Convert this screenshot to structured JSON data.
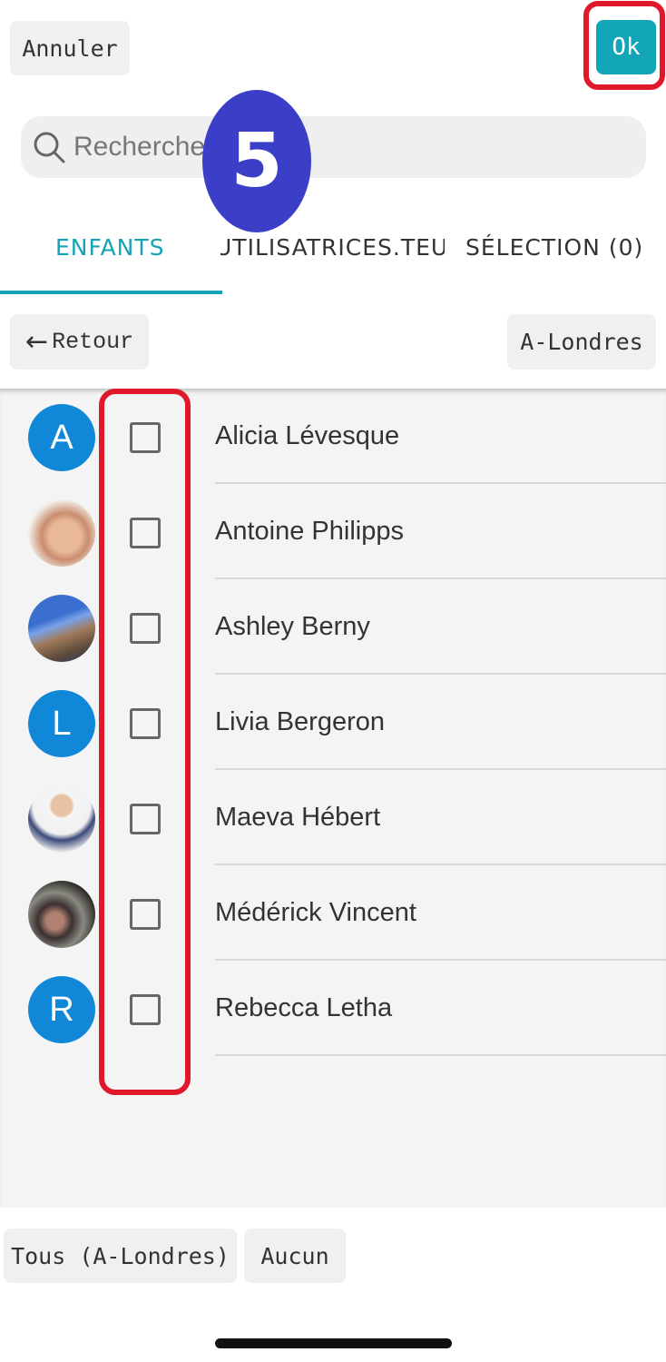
{
  "header": {
    "cancel_label": "Annuler",
    "ok_label": "Ok"
  },
  "search": {
    "placeholder": "Recherche"
  },
  "step_marker": "5",
  "tabs": [
    {
      "label": "ENFANTS",
      "active": true
    },
    {
      "label": "UTILISATRICES.TEURS",
      "active": false
    },
    {
      "label": "SÉLECTION (0)",
      "active": false
    }
  ],
  "nav": {
    "back_label": "Retour",
    "group_label": "A-Londres"
  },
  "children": [
    {
      "name": "Alicia Lévesque",
      "avatar_type": "letter",
      "initial": "A",
      "checked": false
    },
    {
      "name": "Antoine Philipps",
      "avatar_type": "photo",
      "checked": false
    },
    {
      "name": "Ashley Berny",
      "avatar_type": "photo",
      "checked": false
    },
    {
      "name": "Livia Bergeron",
      "avatar_type": "letter",
      "initial": "L",
      "checked": false
    },
    {
      "name": "Maeva Hébert",
      "avatar_type": "photo",
      "checked": false
    },
    {
      "name": "Médérick Vincent",
      "avatar_type": "photo",
      "checked": false
    },
    {
      "name": "Rebecca Letha",
      "avatar_type": "letter",
      "initial": "R",
      "checked": false
    }
  ],
  "footer": {
    "all_label": "Tous (A-Londres)",
    "none_label": "Aucun"
  },
  "colors": {
    "accent": "#14a3b6",
    "ok_button": "#12a5b8",
    "avatar_blue": "#1187d7",
    "highlight_red": "#e0182c",
    "step_badge": "#3b3fc8"
  }
}
